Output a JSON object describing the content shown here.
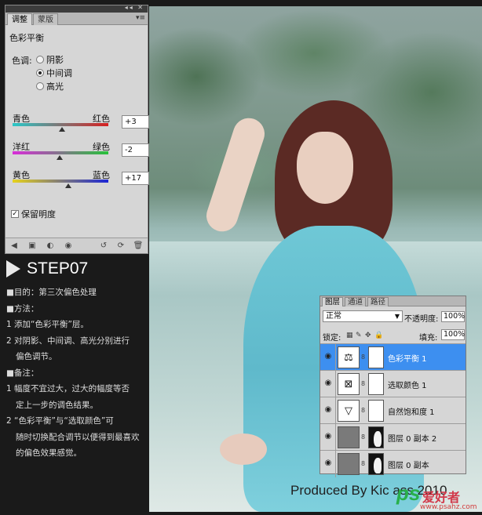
{
  "adjustments": {
    "tabs": [
      "调整",
      "蒙版"
    ],
    "title": "色彩平衡",
    "tone_label": "色调:",
    "tones": [
      {
        "label": "阴影",
        "selected": false
      },
      {
        "label": "中间调",
        "selected": true
      },
      {
        "label": "高光",
        "selected": false
      }
    ],
    "sliders": [
      {
        "left": "青色",
        "right": "红色",
        "value": "+3",
        "level": 3,
        "gradient": [
          "#29c8c8",
          "#d62020"
        ]
      },
      {
        "left": "洋红",
        "right": "绿色",
        "value": "-2",
        "level": -2,
        "gradient": [
          "#d92cd9",
          "#27c23a"
        ]
      },
      {
        "left": "黄色",
        "right": "蓝色",
        "value": "+17",
        "level": 17,
        "gradient": [
          "#e6d21c",
          "#1c26d6"
        ]
      }
    ],
    "preserve_label": "保留明度",
    "preserve_checked": true
  },
  "step": {
    "title": "STEP07",
    "lines": [
      "■目的：第三次偏色处理",
      "■方法：",
      "1 添加“色彩平衡”层。",
      "2 对阴影、中间调、高光分别进行",
      "偏色调节。",
      "■备注：",
      "1 幅度不宜过大，过大的幅度等否",
      "定上一步的调色结果。",
      "2 “色彩平衡”与“选取颜色”可",
      "随时切换配合调节以便得到最喜欢",
      "的偏色效果感觉。"
    ]
  },
  "layers": {
    "tabs": [
      "图层",
      "通道",
      "路径"
    ],
    "blend_mode": "正常",
    "opacity_label": "不透明度:",
    "opacity_value": "100%",
    "lock_label": "锁定:",
    "fill_label": "填充:",
    "fill_value": "100%",
    "items": [
      {
        "name": "色彩平衡 1",
        "selected": true,
        "icon": "scale-icon"
      },
      {
        "name": "选取颜色 1",
        "selected": false,
        "icon": "selective-color-icon"
      },
      {
        "name": "自然饱和度 1",
        "selected": false,
        "icon": "vibrance-icon"
      },
      {
        "name": "图层 0 副本 2",
        "selected": false,
        "icon": "layer-mask-icon"
      },
      {
        "name": "图层 0 副本",
        "selected": false,
        "icon": "layer-mask-icon"
      }
    ]
  },
  "watermark": {
    "produced": "Produced By Kic   ass 2010",
    "logo_ps": "ps",
    "logo_cn": "爱好者",
    "url": "www.psahz.com"
  }
}
